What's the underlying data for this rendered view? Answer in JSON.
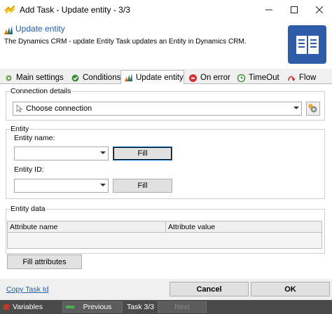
{
  "window": {
    "title": "Add Task - Update entity - 3/3",
    "minimize_icon": "minimize-icon",
    "maximize_icon": "maximize-icon",
    "close_icon": "close-icon"
  },
  "header": {
    "title": "Update entity",
    "description": "The Dynamics CRM - update Entity Task updates an Entity in Dynamics CRM.",
    "icon": "book-icon"
  },
  "tabs": [
    {
      "label": "Main settings",
      "icon": "settings-icon"
    },
    {
      "label": "Conditions",
      "icon": "conditions-icon"
    },
    {
      "label": "Update entity",
      "icon": "dynamics-icon"
    },
    {
      "label": "On error",
      "icon": "error-icon"
    },
    {
      "label": "TimeOut",
      "icon": "timeout-icon"
    },
    {
      "label": "Flow",
      "icon": "flow-icon"
    }
  ],
  "connection": {
    "group_label": "Connection details",
    "placeholder": "Choose connection"
  },
  "entity": {
    "group_label": "Entity",
    "name_label": "Entity name:",
    "id_label": "Entity ID:",
    "fill_label": "Fill",
    "fill2_label": "Fill"
  },
  "entity_data": {
    "group_label": "Entity data",
    "columns": [
      "Attribute name",
      "Attribute value"
    ],
    "fill_attributes_label": "Fill attributes"
  },
  "footer": {
    "copy_link": "Copy Task Id",
    "cancel_label": "Cancel",
    "ok_label": "OK"
  },
  "statusbar": {
    "variables_label": "Variables",
    "previous_label": "Previous",
    "task_counter": "Task 3/3",
    "next_label": "Next"
  },
  "colors": {
    "accent": "#1f5ea8",
    "brand_tile": "#2f5ca8",
    "statusbar": "#4a4a4a"
  }
}
